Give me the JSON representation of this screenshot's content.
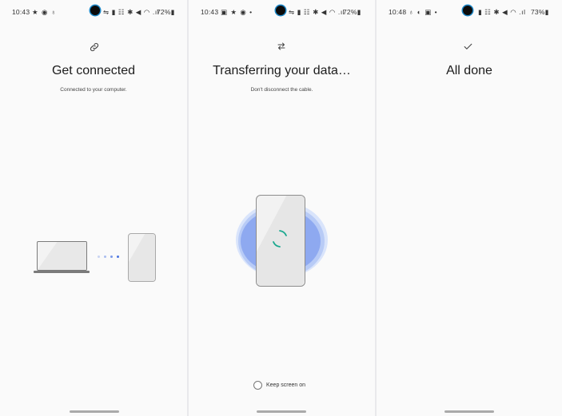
{
  "screens": [
    {
      "status_bar": {
        "time": "10:43",
        "left_icons": "★ ◉ ♁",
        "right_icons": "⇋ ▮ ☷ ✱ ◀ ◠ .ıl",
        "battery": "72%▮"
      },
      "top_icon": "link-icon",
      "title": "Get connected",
      "subtitle": "Connected to your computer.",
      "illustration": "laptop-to-phone",
      "dot_colors": [
        "#c9d4f2",
        "#a9bdef",
        "#7a99ea",
        "#4a74e0"
      ]
    },
    {
      "status_bar": {
        "time": "10:43",
        "left_icons": "▣ ★ ◉ •",
        "right_icons": "⇋ ▮ ☷ ✱ ◀ ◠ .ıl",
        "battery": "72%▮"
      },
      "top_icon": "transfer-arrows-icon",
      "title": "Transferring your data…",
      "subtitle": "Don't disconnect the cable.",
      "illustration": "phone-with-spinner",
      "keep_screen_on": {
        "label": "Keep screen on",
        "checked": false
      },
      "accent_color": "#1aa88f"
    },
    {
      "status_bar": {
        "time": "10:48",
        "left_icons": "♁ ◐ ▣ •",
        "right_icons": "▮ ☷ ✱ ◀ ◠ .ıl",
        "battery": "73%▮"
      },
      "top_icon": "checkmark-icon",
      "title": "All done"
    }
  ]
}
